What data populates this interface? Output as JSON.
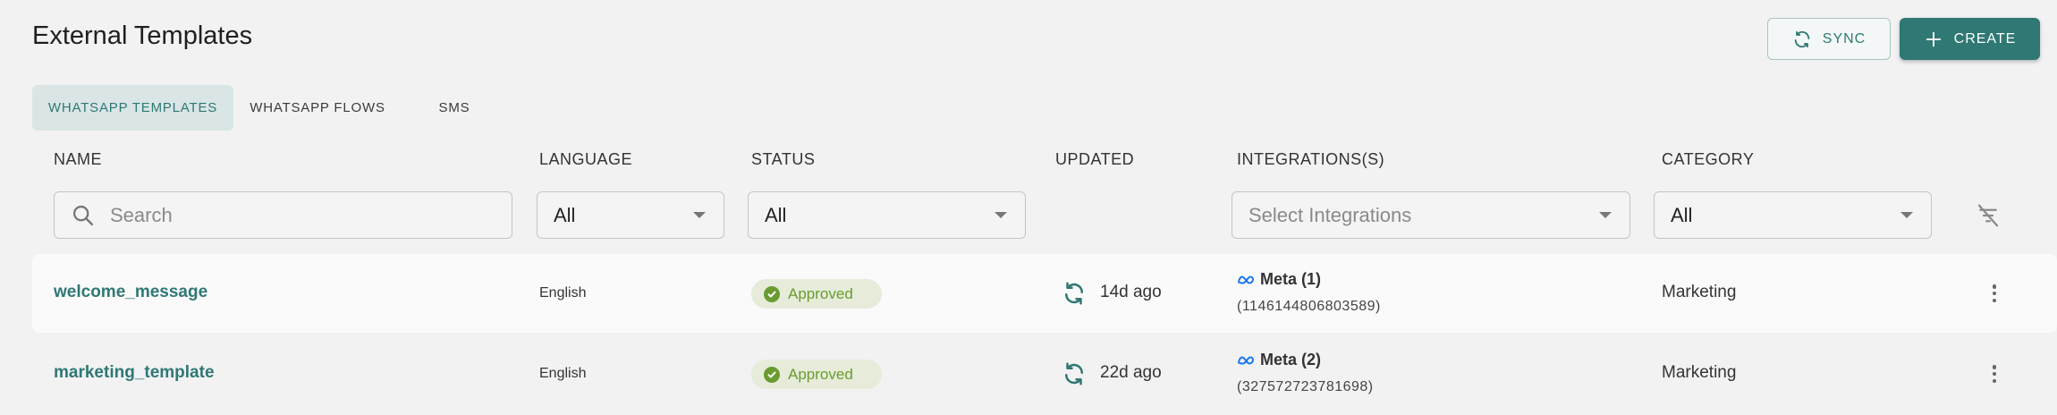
{
  "page": {
    "title": "External Templates"
  },
  "actions": {
    "sync_label": "SYNC",
    "create_label": "CREATE"
  },
  "tabs": [
    {
      "label": "WHATSAPP TEMPLATES",
      "active": true
    },
    {
      "label": "WHATSAPP FLOWS",
      "active": false
    },
    {
      "label": "SMS",
      "active": false
    }
  ],
  "columns": [
    "NAME",
    "LANGUAGE",
    "STATUS",
    "UPDATED",
    "INTEGRATIONS(S)",
    "CATEGORY"
  ],
  "filters": {
    "search_placeholder": "Search",
    "language": "All",
    "status": "All",
    "integrations_placeholder": "Select Integrations",
    "category": "All"
  },
  "rows": [
    {
      "name": "welcome_message",
      "language": "English",
      "status": "Approved",
      "updated": "14d ago",
      "integration": "Meta (1)",
      "integration_id": "(1146144806803589)",
      "category": "Marketing"
    },
    {
      "name": "marketing_template",
      "language": "English",
      "status": "Approved",
      "updated": "22d ago",
      "integration": "Meta (2)",
      "integration_id": "(327572723781698)",
      "category": "Marketing"
    }
  ],
  "colors": {
    "accent": "#2f7874",
    "approved_text": "#6a9b30",
    "approved_bg": "#e6ecd9",
    "meta_blue": "#1877f2"
  },
  "icons": [
    "sync-icon",
    "plus-icon",
    "search-icon",
    "caret-down-icon",
    "filter-off-icon",
    "check-icon",
    "refresh-icon",
    "meta-icon",
    "more-vertical-icon"
  ]
}
